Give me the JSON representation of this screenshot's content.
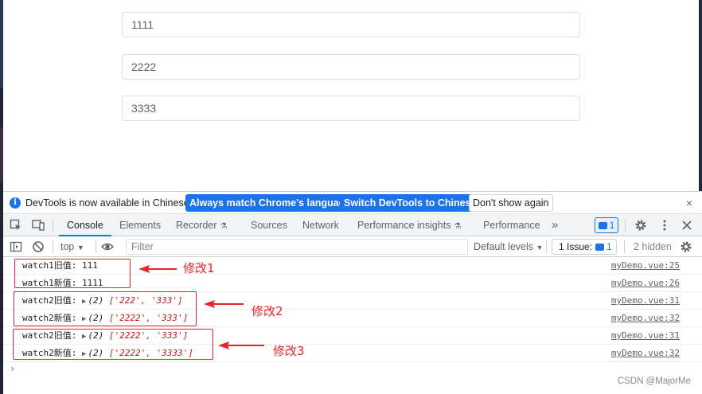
{
  "page": {
    "inputs": [
      "1111",
      "2222",
      "3333"
    ]
  },
  "devtools": {
    "infobar": {
      "text": "DevTools is now available in Chinese!",
      "btn_match": "Always match Chrome's language",
      "btn_switch": "Switch DevTools to Chinese",
      "btn_dismiss": "Don't show again",
      "close": "×"
    },
    "tabs": {
      "console": "Console",
      "elements": "Elements",
      "recorder": "Recorder",
      "sources": "Sources",
      "network": "Network",
      "perf_insights": "Performance insights",
      "performance": "Performance",
      "more": "»",
      "message_count": "1"
    },
    "toolbar": {
      "context": "top",
      "filter_placeholder": "Filter",
      "levels": "Default levels",
      "issues_label": "1 Issue:",
      "issues_count": "1",
      "hidden": "2 hidden"
    },
    "console": {
      "rows": [
        {
          "prefix": "watch1旧值: ",
          "value": "111",
          "source": "myDemo.vue:25"
        },
        {
          "prefix": "watch1新值: ",
          "value": "1111",
          "source": "myDemo.vue:26"
        },
        {
          "prefix": "watch2旧值: ",
          "count": "(2)",
          "values": "['222', '333']",
          "source": "myDemo.vue:31"
        },
        {
          "prefix": "watch2新值: ",
          "count": "(2)",
          "values": "['2222', '333']",
          "source": "myDemo.vue:32"
        },
        {
          "prefix": "watch2旧值: ",
          "count": "(2)",
          "values": "['2222', '333']",
          "source": "myDemo.vue:31"
        },
        {
          "prefix": "watch2新值: ",
          "count": "(2)",
          "values": "['2222', '3333']",
          "source": "myDemo.vue:32"
        }
      ],
      "prompt": "›"
    }
  },
  "annotations": {
    "label1": "修改1",
    "label2": "修改2",
    "label3": "修改3",
    "color": "#e8242a"
  },
  "watermark": "CSDN @MajorMe"
}
